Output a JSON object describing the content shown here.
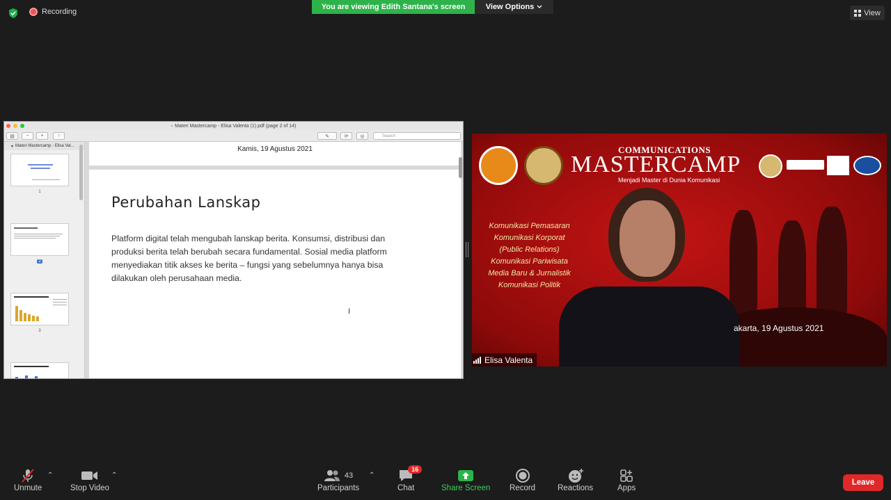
{
  "top": {
    "recording_label": "Recording",
    "viewing_banner": "You are viewing Edith Santana's screen",
    "view_options": "View Options",
    "view_button": "View"
  },
  "preview": {
    "window_title": "Materi Mastercamp - Elisa Valenta (1).pdf (page 2 of 14)",
    "search_placeholder": "Search",
    "sidebar_title": "Materi Mastercamp - Elisa Val...",
    "thumb_labels": [
      "1",
      "2",
      "3"
    ],
    "page1_date": "Kamis, 19 Agustus 2021",
    "page2_title": "Perubahan Lanskap",
    "page2_body": "Platform digital telah mengubah lanskap berita. Konsumsi, distribusi dan produksi berita telah berubah secara fundamental. Sosial media platform menyediakan titik akses ke berita – fungsi yang sebelumnya hanya bisa dilakukan oleh perusahaan media."
  },
  "video": {
    "banner_top": "COMMUNICATIONS",
    "banner_main": "MASTERCAMP",
    "banner_sub": "Menjadi Master di Dunia Komunikasi",
    "topics": [
      "Komunikasi Pemasaran",
      "Komunikasi Korporat",
      "(Public Relations)",
      "Komunikasi Pariwisata",
      "Media Baru & Jurnalistik",
      "Komunikasi Politik"
    ],
    "date_text": "akarta, 19 Agustus 2021",
    "participant_name": "Elisa Valenta"
  },
  "toolbar": {
    "unmute": "Unmute",
    "stop_video": "Stop Video",
    "participants": "Participants",
    "participant_count": "43",
    "chat": "Chat",
    "chat_badge": "16",
    "share_screen": "Share Screen",
    "record": "Record",
    "reactions": "Reactions",
    "apps": "Apps",
    "leave": "Leave"
  },
  "colors": {
    "accent_green": "#2db34a",
    "leave_red": "#e02828"
  }
}
